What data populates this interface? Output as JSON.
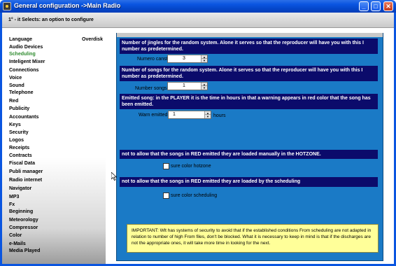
{
  "window": {
    "title": "General configuration ->Main Radio",
    "buttons": {
      "minimize": "_",
      "maximize": "□",
      "close": "✕"
    }
  },
  "header": {
    "text": "1° - it Selects: an option to configure"
  },
  "sidebar": {
    "items": [
      {
        "label": "Language"
      },
      {
        "label": "Audio Devices"
      },
      {
        "label": "Scheduling",
        "active": true
      },
      {
        "label": "Inteligent Mixer"
      },
      {
        "label": "Connections"
      },
      {
        "label": "Voice"
      },
      {
        "label": "Sound"
      },
      {
        "label": "Telephone"
      },
      {
        "label": "Red"
      },
      {
        "label": "Publicity"
      },
      {
        "label": "Accountants"
      },
      {
        "label": "Keys"
      },
      {
        "label": "Security"
      },
      {
        "label": "Logos"
      },
      {
        "label": "Receipts"
      },
      {
        "label": "Contracts"
      },
      {
        "label": "Fiscal Data"
      },
      {
        "label": "Publi manager"
      },
      {
        "label": "Radio internet"
      },
      {
        "label": "Navigator"
      },
      {
        "label": "MP3"
      },
      {
        "label": "Fx"
      },
      {
        "label": "Beginning"
      },
      {
        "label": "Meteorology"
      },
      {
        "label": "Compressor"
      },
      {
        "label": "Color"
      },
      {
        "label": "e-Mails"
      },
      {
        "label": "Media Played"
      }
    ],
    "overdisk": "Overdisk"
  },
  "main": {
    "jingles": {
      "description": "Number of jingles for the random system. Alone it serves so that the reproducer will have you with this I number as predetermined.",
      "label": "Numero canstas :",
      "value": "3"
    },
    "songs": {
      "description": "Number of songs for the random system. Alone it serves so that the reproducer will have you with this I number as predetermined.",
      "label": "Number songs:",
      "value": "1"
    },
    "emitted": {
      "description": "Emitted song: in the PLAYER it is the time in hours in that a warning appears in red color that the song has been emitted.",
      "label": "Warn emitted:",
      "value": "1",
      "unit": "hours"
    },
    "hotzone": {
      "description": "not to allow that the songs in RED emitted they are loaded manually in the HOTZONE.",
      "checkbox_label": "sure color hotzone"
    },
    "scheduling": {
      "description": "not to allow that the songs in RED emitted they are loaded by the scheduling",
      "checkbox_label": "sure color scheduling"
    },
    "important": "IMPORTANT: Wlt has systems of security to avoid that if the established conditions From scheduling are not adapted in relation to number of high From files, don't be blocked. What it is necessary to keep in mind is that if the discharges are not the appropriate ones, it will take more time in looking for the next."
  },
  "colors": {
    "titlebar": "#0a55e0",
    "panel": "#1a7ac6",
    "navybar": "#0b0b6b",
    "active_menu": "#2e8b2e",
    "important_bg": "#ffff99"
  }
}
